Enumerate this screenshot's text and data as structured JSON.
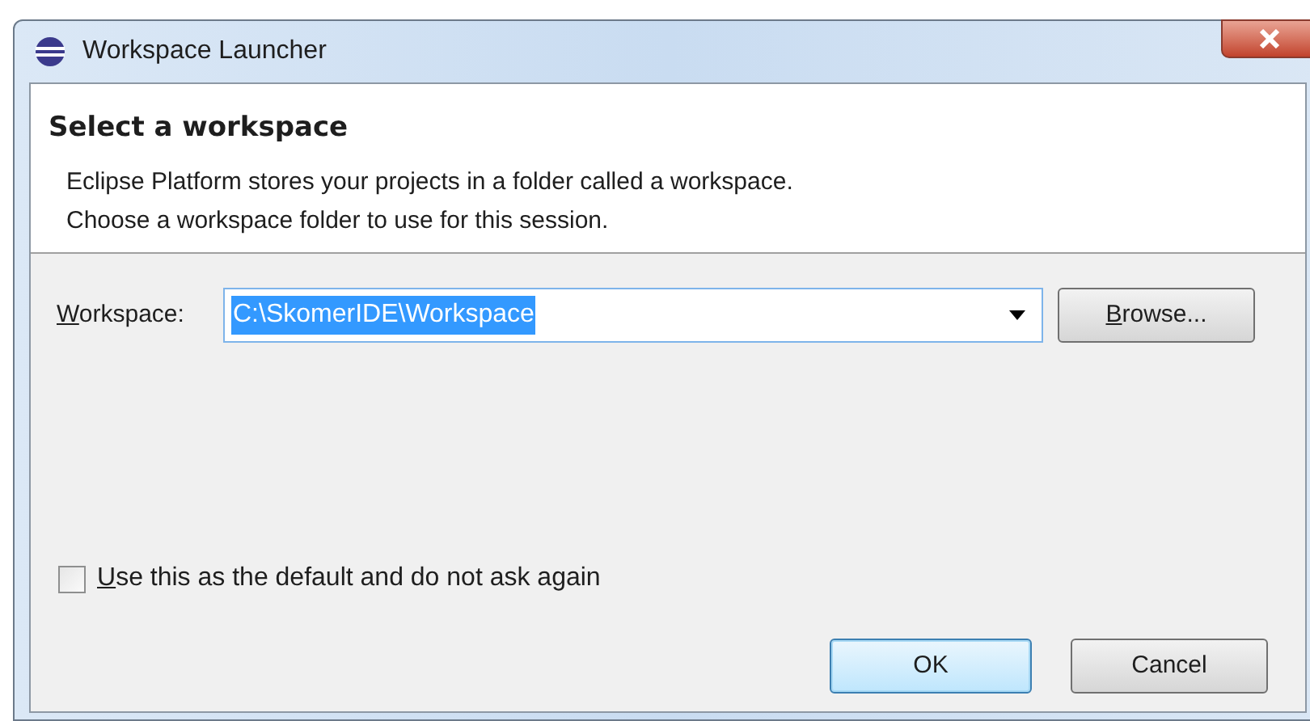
{
  "window": {
    "title": "Workspace Launcher"
  },
  "header": {
    "title": "Select a workspace",
    "description": [
      "Eclipse Platform stores your projects in a folder called a workspace.",
      "Choose a workspace folder to use for this session."
    ]
  },
  "workspace": {
    "label": "Workspace:",
    "label_mnemonic": true,
    "value": "C:\\SkomerIDE\\Workspace",
    "value_selected": true,
    "browse": {
      "label": "Browse...",
      "mnemonic": true
    }
  },
  "default_checkbox": {
    "label": "Use this as the default and do not ask again",
    "mnemonic": true,
    "checked": false
  },
  "buttons": [
    {
      "label": "OK",
      "default": true
    },
    {
      "label": "Cancel",
      "default": false
    }
  ]
}
